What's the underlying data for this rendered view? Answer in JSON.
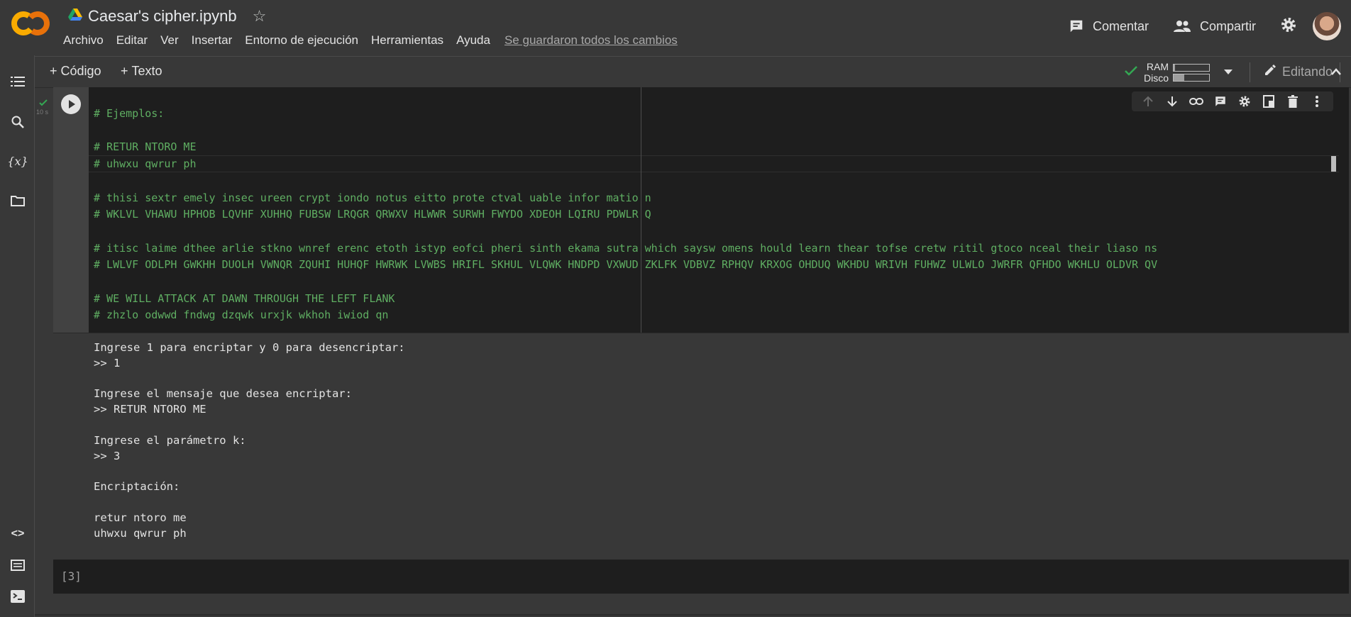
{
  "app": {
    "notebook_title": "Caesar's cipher.ipynb",
    "menu": [
      "Archivo",
      "Editar",
      "Ver",
      "Insertar",
      "Entorno de ejecución",
      "Herramientas",
      "Ayuda"
    ],
    "save_status": "Se guardaron todos los cambios",
    "comment_label": "Comentar",
    "share_label": "Compartir"
  },
  "toolbar": {
    "add_code": "Código",
    "add_text": "Texto",
    "ram_label": "RAM",
    "disk_label": "Disco",
    "ram_usage": 0.03,
    "disk_usage": 0.3,
    "editing_label": "Editando"
  },
  "cell": {
    "execution_time": "10 s",
    "code": "# Ejemplos:\n\n# RETUR NTORO ME\n# uhwxu qwrur ph\n\n# thisi sextr emely insec ureen crypt iondo notus eitto prote ctval uable infor matio n\n# WKLVL VHAWU HPHOB LQVHF XUHHQ FUBSW LRQGR QRWXV HLWWR SURWH FWYDO XDEOH LQIRU PDWLR Q\n\n# itisc laime dthee arlie stkno wnref erenc etoth istyp eofci pheri sinth ekama sutra which saysw omens hould learn thear tofse cretw ritil gtoco nceal their liaso ns\n# LWLVF ODLPH GWKHH DUOLH VWNQR ZQUHI HUHQF HWRWK LVWBS HRIFL SKHUL VLQWK HNDPD VXWUD ZKLFK VDBVZ RPHQV KRXOG OHDUQ WKHDU WRIVH FUHWZ ULWLO JWRFR QFHDO WKHLU OLDVR QV\n\n# WE WILL ATTACK AT DAWN THROUGH THE LEFT FLANK\n# zhzlo odwwd fndwg dzqwk urxjk wkhoh iwiod qn",
    "output": "Ingrese 1 para encriptar y 0 para desencriptar:\n>> 1\n\nIngrese el mensaje que desea encriptar:\n>> RETUR NTORO ME\n\nIngrese el parámetro k:\n>> 3\n\nEncriptación:\n\nretur ntoro me\nuhwxu qwrur ph"
  },
  "cell2": {
    "label": "[3]"
  },
  "colors": {
    "accent_green": "#34a853",
    "code_green": "#5fae62",
    "logo_orange": "#f9ab00"
  }
}
